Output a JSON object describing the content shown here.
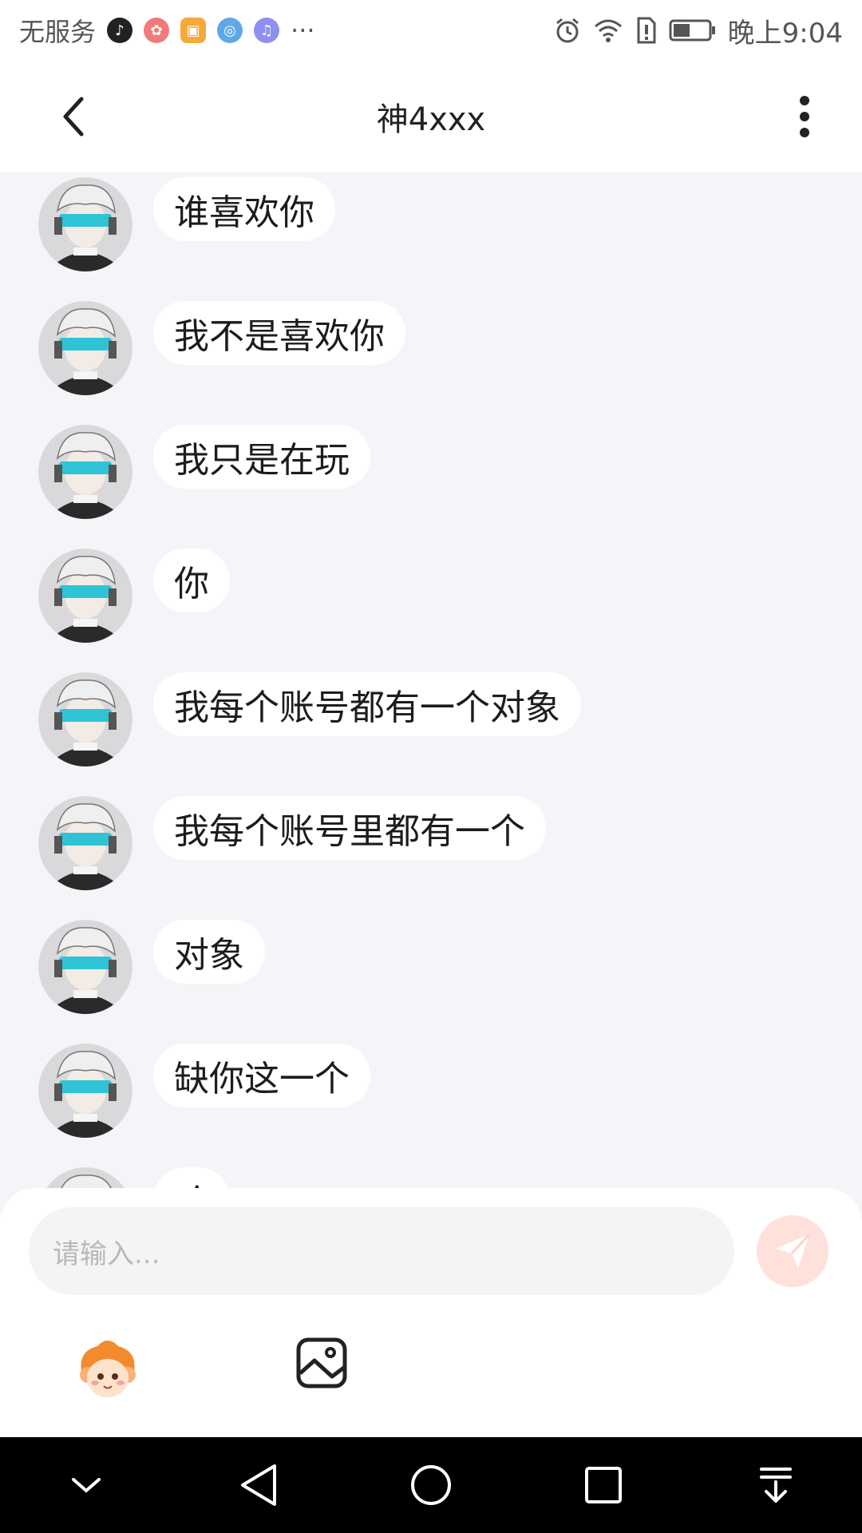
{
  "status_bar": {
    "carrier": "无服务",
    "more_notifications": "···",
    "time": "晚上9:04",
    "app_icons": [
      "tiktok-icon",
      "flower-app-icon",
      "store-app-icon",
      "globe-app-icon",
      "music-app-icon"
    ]
  },
  "header": {
    "title": "神4xxx"
  },
  "messages": [
    {
      "text": "谁喜欢你"
    },
    {
      "text": "我不是喜欢你"
    },
    {
      "text": "我只是在玩"
    },
    {
      "text": "你"
    },
    {
      "text": "我每个账号都有一个对象"
    },
    {
      "text": "我每个账号里都有一个"
    },
    {
      "text": "对象"
    },
    {
      "text": "缺你这一个"
    },
    {
      "text": "哈"
    }
  ],
  "input": {
    "placeholder": "请输入..."
  },
  "colors": {
    "background": "#f4f5f8",
    "bubble": "#ffffff",
    "send_button": "#ffe1dc",
    "avatar_accent": "#2ec4d6"
  }
}
